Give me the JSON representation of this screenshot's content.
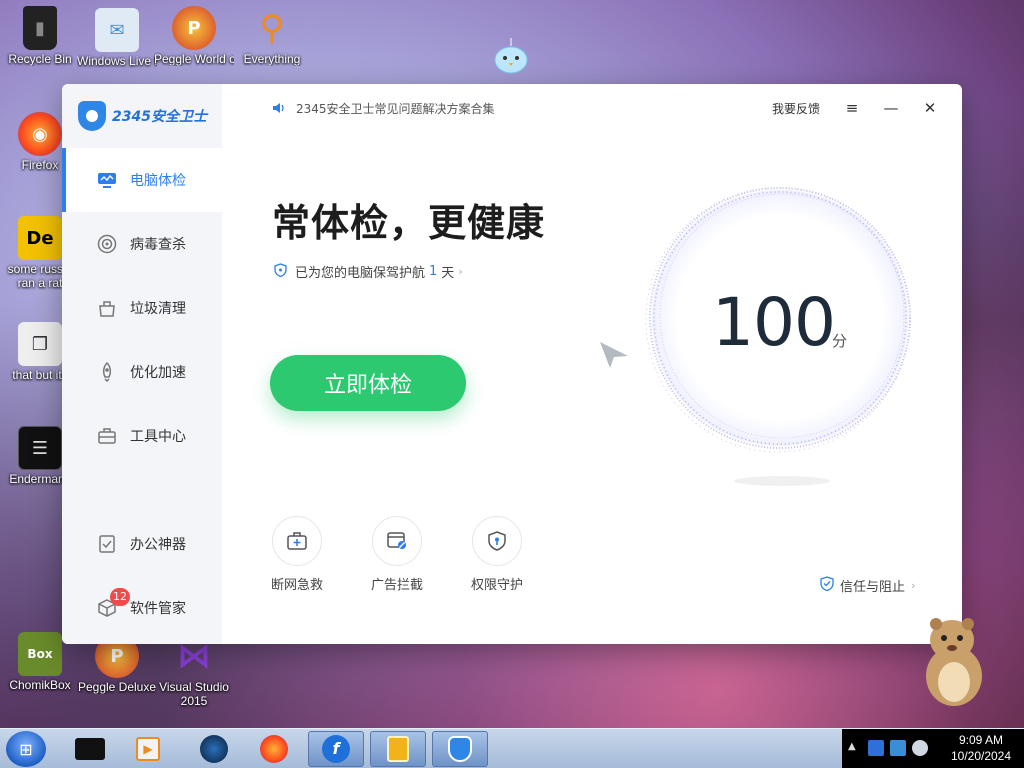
{
  "desktop": {
    "icons": [
      {
        "label": "Recycle Bin",
        "glyph": "▮",
        "color": "#2a2a2a"
      },
      {
        "label": "Windows Live Mail",
        "glyph": "✉",
        "color": "#6fb2e8"
      },
      {
        "label": "Peggle World of Warcraft ...",
        "glyph": "P",
        "color": "#d13a2a"
      },
      {
        "label": "Everything",
        "glyph": "⚲",
        "color": "#f08a1c"
      },
      {
        "label": "Firefox",
        "glyph": "◉",
        "color": "#ff6a1c"
      },
      {
        "label": "some russia ran a rat",
        "glyph": "De",
        "color": "#f2c200"
      },
      {
        "label": "that but its",
        "glyph": "❐",
        "color": "#444"
      },
      {
        "label": "Endermanc",
        "glyph": "☰",
        "color": "#111"
      },
      {
        "label": "ChomikBox",
        "glyph": "Box",
        "color": "#6a8b2b"
      },
      {
        "label": "Peggle Deluxe",
        "glyph": "P",
        "color": "#d13a2a"
      },
      {
        "label": "Visual Studio 2015",
        "glyph": "⋈",
        "color": "#6a2fa8"
      }
    ]
  },
  "app": {
    "brand": "2345安全卫士",
    "notice": "2345安全卫士常见问题解决方案合集",
    "feedback": "我要反馈",
    "window_controls": {
      "menu": "≡",
      "minimize": "—",
      "close": "✕"
    },
    "nav": [
      {
        "label": "电脑体检",
        "icon": "monitor-icon",
        "active": true
      },
      {
        "label": "病毒查杀",
        "icon": "target-icon"
      },
      {
        "label": "垃圾清理",
        "icon": "basket-icon"
      },
      {
        "label": "优化加速",
        "icon": "rocket-icon"
      },
      {
        "label": "工具中心",
        "icon": "toolbox-icon"
      },
      {
        "label": "办公神器",
        "icon": "checklist-icon"
      },
      {
        "label": "软件管家",
        "icon": "box-icon",
        "badge": "12"
      }
    ],
    "headline": "常体检，更健康",
    "protect": {
      "prefix": "已为您的电脑保驾护航",
      "days": "1",
      "suffix": "天"
    },
    "scan_button": "立即体检",
    "score": {
      "value": "100",
      "unit": "分"
    },
    "tools": [
      {
        "label": "断网急救",
        "icon": "first-aid-icon"
      },
      {
        "label": "广告拦截",
        "icon": "ad-block-icon"
      },
      {
        "label": "权限守护",
        "icon": "shield-key-icon"
      }
    ],
    "trust": "信任与阻止",
    "accent": "#2e7ef0",
    "green": "#2cc971"
  },
  "taskbar": {
    "clock_time": "9:09 AM",
    "clock_date": "10/20/2024",
    "items": [
      "media-center-icon",
      "media-player-icon",
      "globe-icon",
      "firefox-icon",
      "flash-icon",
      "app-icon",
      "2345-guard-icon"
    ]
  }
}
